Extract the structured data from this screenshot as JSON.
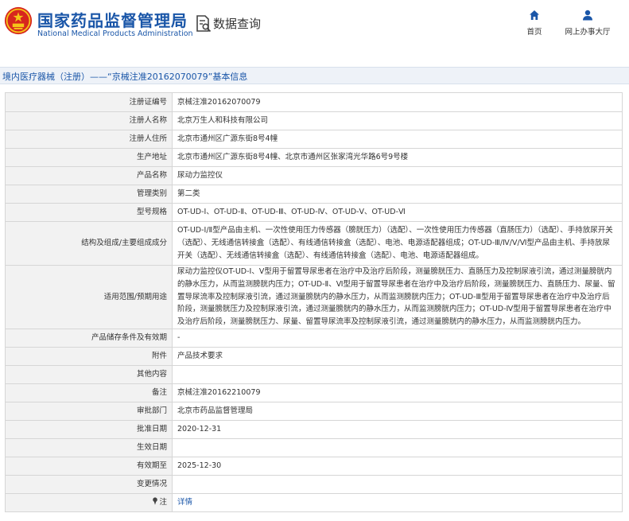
{
  "header": {
    "brand_cn": "国家药品监督管理局",
    "brand_en": "National Medical Products Administration",
    "query_title": "数据查询",
    "nav_home": "首页",
    "nav_hall": "网上办事大厅"
  },
  "section": {
    "title": "境内医疗器械（注册）——“京械注准20162070079”基本信息"
  },
  "rows": [
    {
      "label": "注册证编号",
      "value": "京械注准20162070079"
    },
    {
      "label": "注册人名称",
      "value": "北京万生人和科技有限公司"
    },
    {
      "label": "注册人住所",
      "value": "北京市通州区广源东街8号4幢"
    },
    {
      "label": "生产地址",
      "value": "北京市通州区广源东街8号4幢、北京市通州区张家湾光华路6号9号楼"
    },
    {
      "label": "产品名称",
      "value": "尿动力监控仪"
    },
    {
      "label": "管理类别",
      "value": "第二类"
    },
    {
      "label": "型号规格",
      "value": "OT-UD-Ⅰ、OT-UD-Ⅱ、OT-UD-Ⅲ、OT-UD-Ⅳ、OT-UD-Ⅴ、OT-UD-Ⅵ"
    },
    {
      "label": "结构及组成/主要组成成分",
      "value": "OT-UD-Ⅰ/Ⅱ型产品由主机、一次性使用压力传感器（膀胱压力）（选配）、一次性使用压力传感器（直肠压力）（选配）、手持放尿开关（选配）、无线通信转接盒（选配）、有线通信转接盒（选配）、电池、电源适配器组成；OT-UD-Ⅲ/Ⅳ/Ⅴ/Ⅵ型产品由主机、手持放尿开关（选配）、无线通信转接盒（选配）、有线通信转接盒（选配）、电池、电源适配器组成。"
    },
    {
      "label": "适用范围/预期用途",
      "value": "尿动力监控仪OT-UD-Ⅰ、Ⅴ型用于留置导尿患者在治疗中及治疗后阶段，测量膀胱压力、直肠压力及控制尿液引流，通过测量膀胱内的静水压力，从而监测膀胱内压力；OT-UD-Ⅱ、Ⅵ型用于留置导尿患者在治疗中及治疗后阶段，测量膀胱压力、直肠压力、尿量、留置导尿流率及控制尿液引流，通过测量膀胱内的静水压力，从而监测膀胱内压力；OT-UD-Ⅲ型用于留置导尿患者在治疗中及治疗后阶段，测量膀胱压力及控制尿液引流，通过测量膀胱内的静水压力，从而监测膀胱内压力；OT-UD-Ⅳ型用于留置导尿患者在治疗中及治疗后阶段，测量膀胱压力、尿量、留置导尿流率及控制尿液引流，通过测量膀胱内的静水压力，从而监测膀胱内压力。"
    },
    {
      "label": "产品储存条件及有效期",
      "value": "-"
    },
    {
      "label": "附件",
      "value": "产品技术要求"
    },
    {
      "label": "其他内容",
      "value": ""
    },
    {
      "label": "备注",
      "value": "京械注准20162210079"
    },
    {
      "label": "审批部门",
      "value": "北京市药品监督管理局"
    },
    {
      "label": "批准日期",
      "value": "2020-12-31"
    },
    {
      "label": "生效日期",
      "value": ""
    },
    {
      "label": "有效期至",
      "value": "2025-12-30"
    },
    {
      "label": "变更情况",
      "value": ""
    },
    {
      "label": "注",
      "value": "详情"
    }
  ],
  "colors": {
    "brand_blue": "#1a56a8",
    "emblem_red": "#d7261e",
    "emblem_gold": "#f5c518"
  },
  "icons": {
    "emblem": "national-emblem-icon",
    "query": "document-search-icon",
    "home": "home-icon",
    "hall": "user-icon",
    "note": "pin-icon"
  }
}
